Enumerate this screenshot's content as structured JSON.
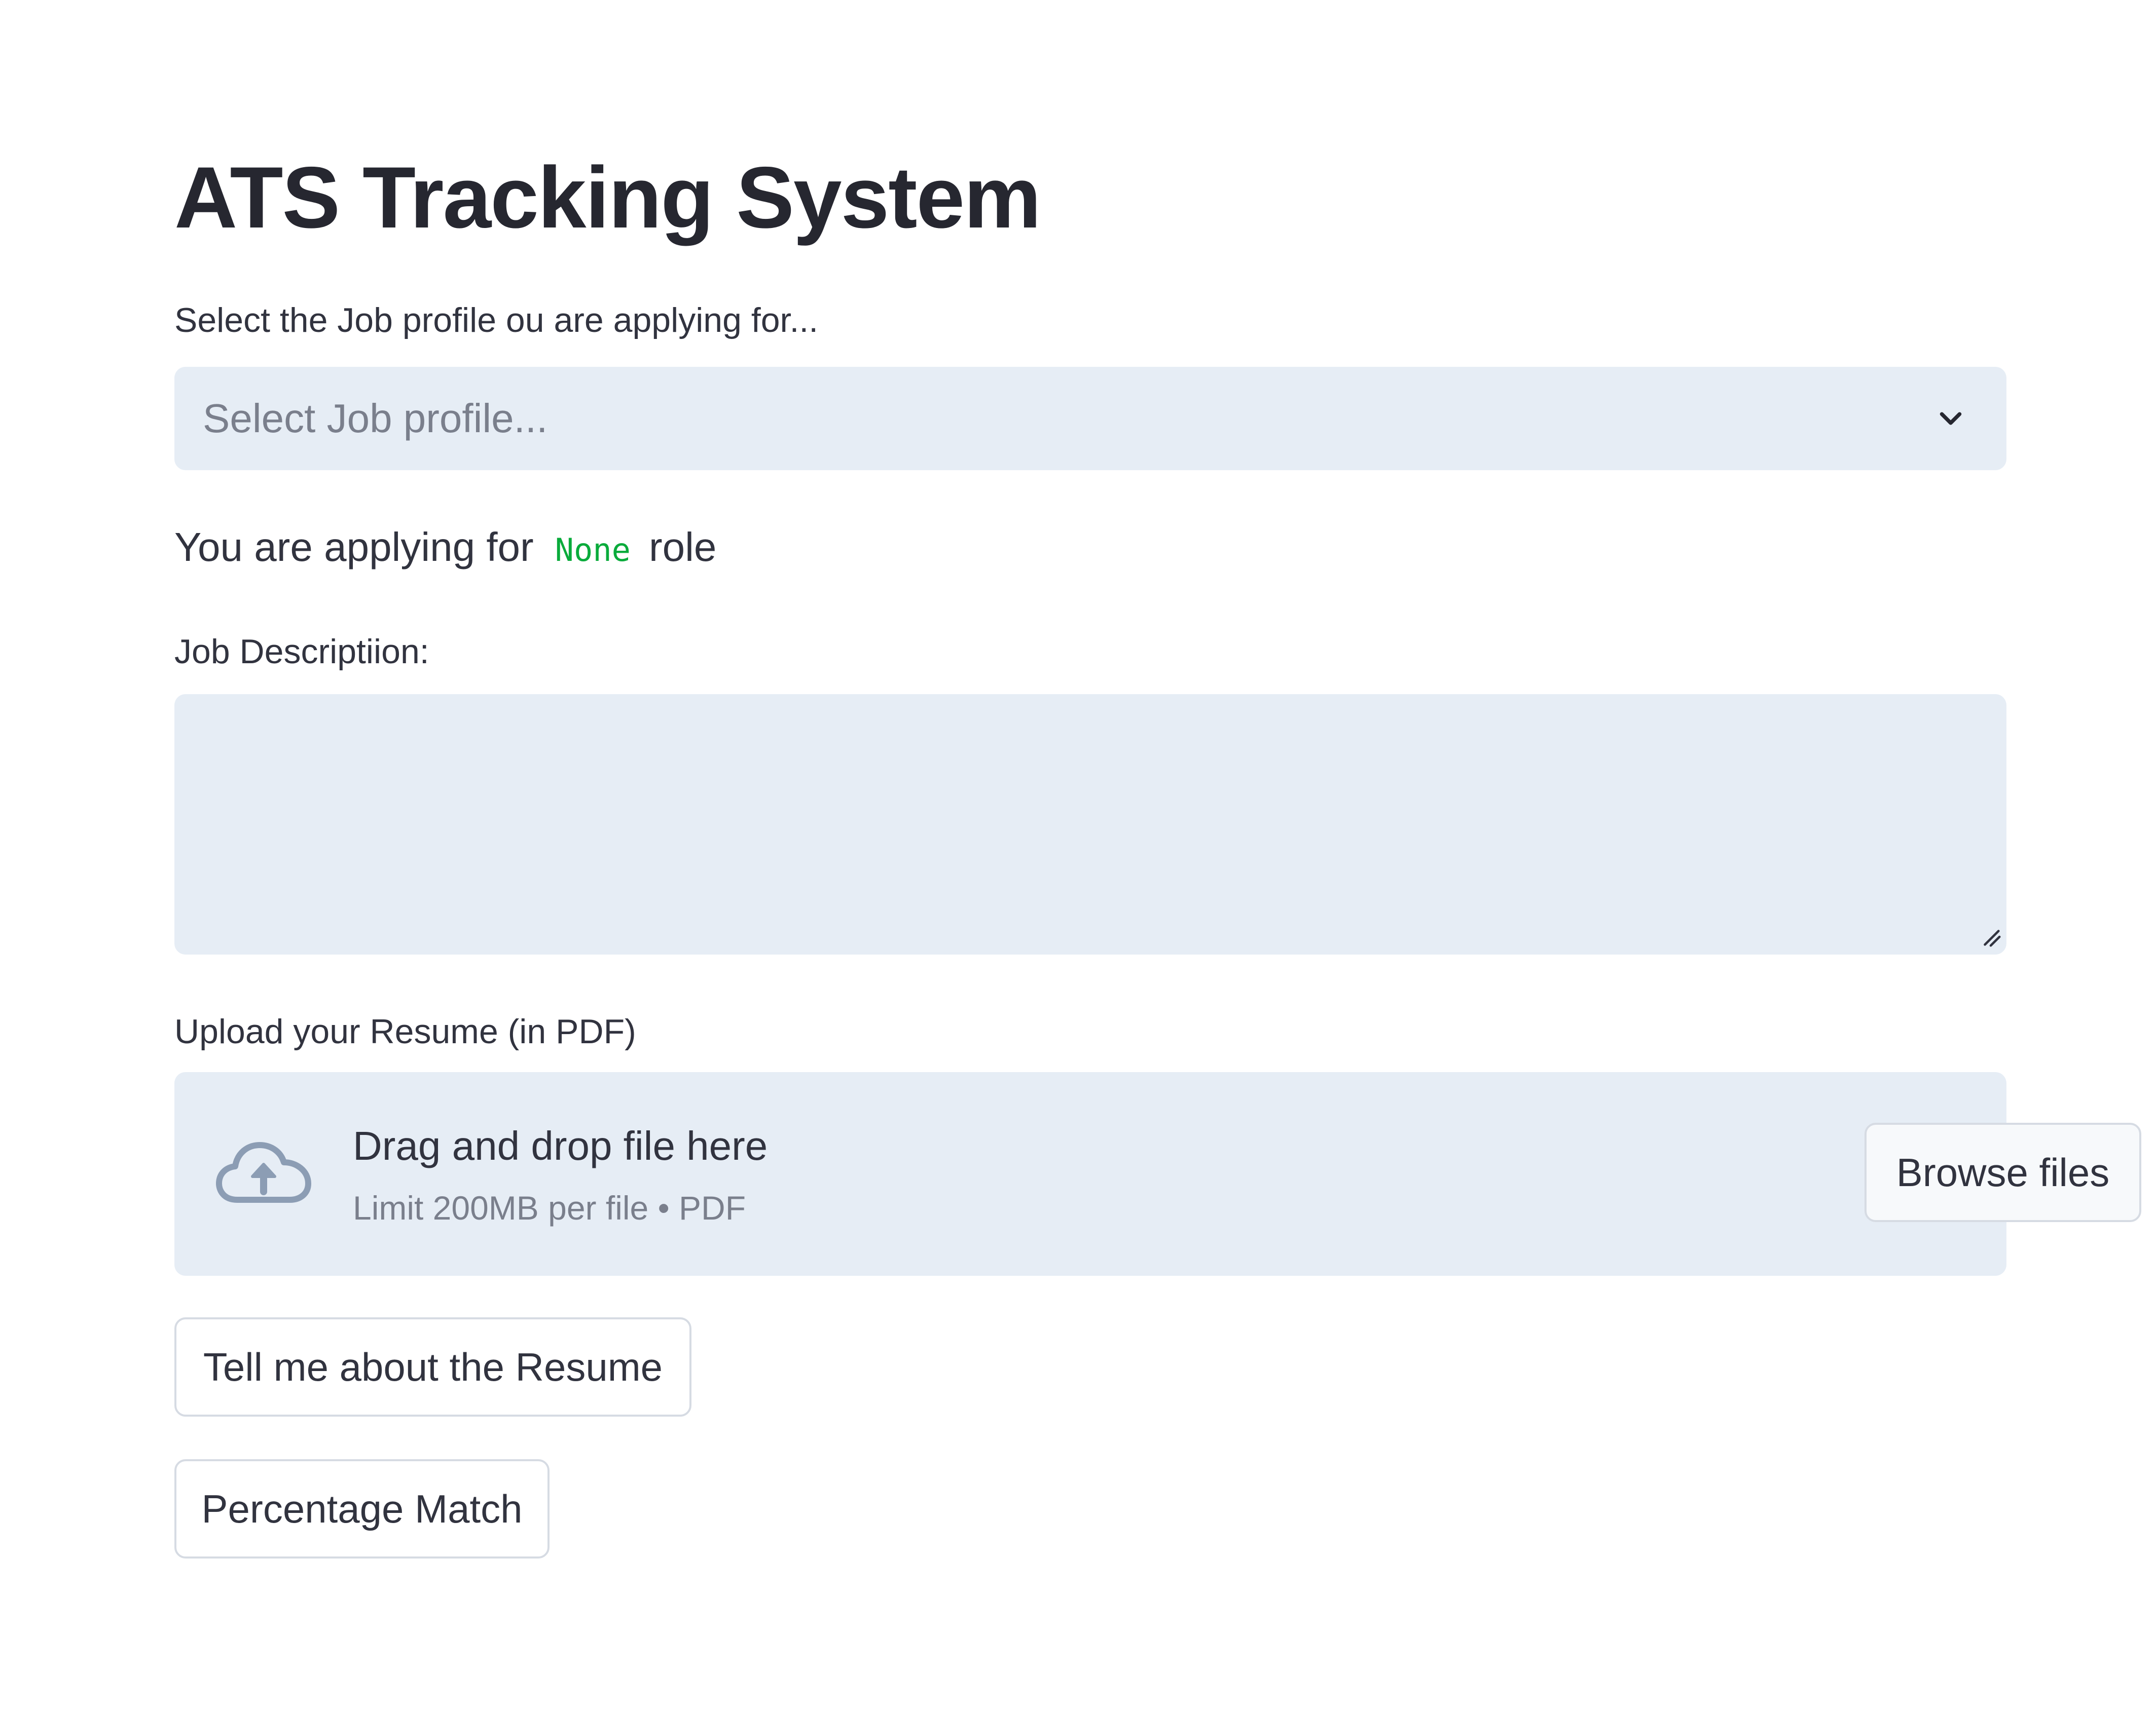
{
  "page": {
    "title": "ATS Tracking System"
  },
  "job_profile": {
    "label": "Select the Job profile ou are applying for...",
    "placeholder": "Select Job profile...",
    "chevron_icon": "chevron-down-icon"
  },
  "applying": {
    "prefix": "You are applying for",
    "role_value": "None",
    "suffix": "role",
    "role_color": "#09ab3b"
  },
  "job_description": {
    "label": "Job Descriptiion:",
    "value": ""
  },
  "upload": {
    "label": "Upload your Resume (in PDF)",
    "dropzone_title": "Drag and drop file here",
    "dropzone_hint": "Limit 200MB per file • PDF",
    "browse_label": "Browse files",
    "icon": "cloud-upload-icon"
  },
  "actions": {
    "tell_label": "Tell me about the Resume",
    "percentage_label": "Percentage Match"
  },
  "colors": {
    "input_background": "#e6edf5",
    "text": "#31333f",
    "muted_text": "#7a7f8c"
  }
}
